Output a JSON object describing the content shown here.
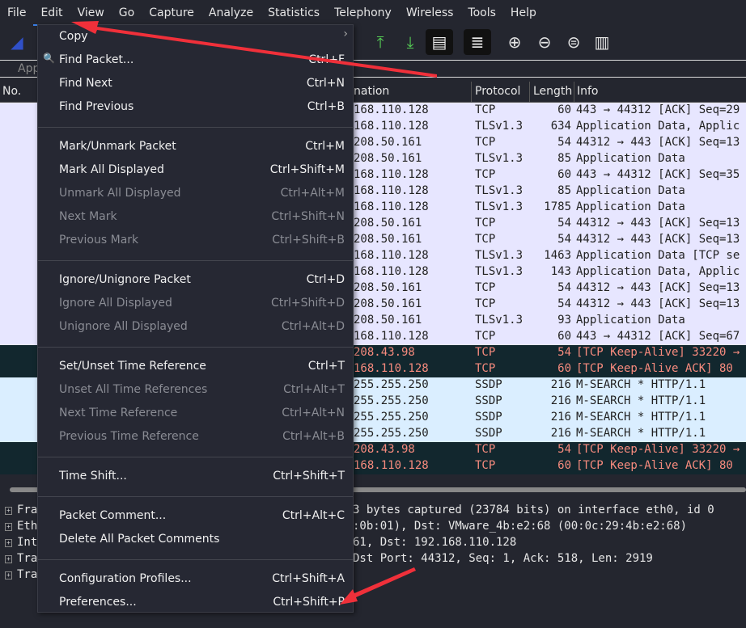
{
  "menubar": [
    "File",
    "Edit",
    "View",
    "Go",
    "Capture",
    "Analyze",
    "Statistics",
    "Telephony",
    "Wireless",
    "Tools",
    "Help"
  ],
  "filter_placeholder": "App",
  "columns": {
    "no": "No.",
    "destination": "nation",
    "protocol": "Protocol",
    "length": "Length",
    "info": "Info"
  },
  "packets": [
    {
      "dst": "168.110.128",
      "proto": "TCP",
      "len": "60",
      "info": "443 → 44312 [ACK] Seq=29",
      "type": "tcp"
    },
    {
      "dst": "168.110.128",
      "proto": "TLSv1.3",
      "len": "634",
      "info": "Application Data, Applic",
      "type": "tcp"
    },
    {
      "dst": "208.50.161",
      "proto": "TCP",
      "len": "54",
      "info": "44312 → 443 [ACK] Seq=13",
      "type": "tcp"
    },
    {
      "dst": "208.50.161",
      "proto": "TLSv1.3",
      "len": "85",
      "info": "Application Data",
      "type": "tcp"
    },
    {
      "dst": "168.110.128",
      "proto": "TCP",
      "len": "60",
      "info": "443 → 44312 [ACK] Seq=35",
      "type": "tcp"
    },
    {
      "dst": "168.110.128",
      "proto": "TLSv1.3",
      "len": "85",
      "info": "Application Data",
      "type": "tcp"
    },
    {
      "dst": "168.110.128",
      "proto": "TLSv1.3",
      "len": "1785",
      "info": "Application Data",
      "type": "tcp"
    },
    {
      "dst": "208.50.161",
      "proto": "TCP",
      "len": "54",
      "info": "44312 → 443 [ACK] Seq=13",
      "type": "tcp"
    },
    {
      "dst": "208.50.161",
      "proto": "TCP",
      "len": "54",
      "info": "44312 → 443 [ACK] Seq=13",
      "type": "tcp"
    },
    {
      "dst": "168.110.128",
      "proto": "TLSv1.3",
      "len": "1463",
      "info": "Application Data [TCP se",
      "type": "tcp"
    },
    {
      "dst": "168.110.128",
      "proto": "TLSv1.3",
      "len": "143",
      "info": "Application Data, Applic",
      "type": "tcp"
    },
    {
      "dst": "208.50.161",
      "proto": "TCP",
      "len": "54",
      "info": "44312 → 443 [ACK] Seq=13",
      "type": "tcp"
    },
    {
      "dst": "208.50.161",
      "proto": "TCP",
      "len": "54",
      "info": "44312 → 443 [ACK] Seq=13",
      "type": "tcp"
    },
    {
      "dst": "208.50.161",
      "proto": "TLSv1.3",
      "len": "93",
      "info": "Application Data",
      "type": "tcp"
    },
    {
      "dst": "168.110.128",
      "proto": "TCP",
      "len": "60",
      "info": "443 → 44312 [ACK] Seq=67",
      "type": "tcp"
    },
    {
      "dst": "208.43.98",
      "proto": "TCP",
      "len": "54",
      "info": "[TCP Keep-Alive] 33220 →",
      "type": "bad"
    },
    {
      "dst": "168.110.128",
      "proto": "TCP",
      "len": "60",
      "info": "[TCP Keep-Alive ACK] 80",
      "type": "bad"
    },
    {
      "dst": "255.255.250",
      "proto": "SSDP",
      "len": "216",
      "info": "M-SEARCH * HTTP/1.1",
      "type": "ssdp"
    },
    {
      "dst": "255.255.250",
      "proto": "SSDP",
      "len": "216",
      "info": "M-SEARCH * HTTP/1.1",
      "type": "ssdp"
    },
    {
      "dst": "255.255.250",
      "proto": "SSDP",
      "len": "216",
      "info": "M-SEARCH * HTTP/1.1",
      "type": "ssdp"
    },
    {
      "dst": "255.255.250",
      "proto": "SSDP",
      "len": "216",
      "info": "M-SEARCH * HTTP/1.1",
      "type": "ssdp"
    },
    {
      "dst": "208.43.98",
      "proto": "TCP",
      "len": "54",
      "info": "[TCP Keep-Alive] 33220 →",
      "type": "bad"
    },
    {
      "dst": "168.110.128",
      "proto": "TCP",
      "len": "60",
      "info": "[TCP Keep-Alive ACK] 80",
      "type": "bad"
    }
  ],
  "details": [
    {
      "label": "Fra",
      "rest": "3 bytes captured (23784 bits) on interface eth0, id 0"
    },
    {
      "label": "Eth",
      "rest": ":0b:01), Dst: VMware_4b:e2:68 (00:0c:29:4b:e2:68)"
    },
    {
      "label": "Int",
      "rest": "61, Dst: 192.168.110.128"
    },
    {
      "label": "Tra",
      "rest": "Dst Port: 44312, Seq: 1, Ack: 518, Len: 2919"
    },
    {
      "label": "Tra",
      "rest": ""
    }
  ],
  "edit_menu": {
    "items": [
      {
        "label": "Copy",
        "shortcut": "",
        "disabled": false,
        "submenu": true
      },
      {
        "label": "Find Packet...",
        "shortcut": "Ctrl+F",
        "disabled": false,
        "icon": "search-icon"
      },
      {
        "label": "Find Next",
        "shortcut": "Ctrl+N",
        "disabled": false
      },
      {
        "label": "Find Previous",
        "shortcut": "Ctrl+B",
        "disabled": false
      },
      {
        "sep": true
      },
      {
        "label": "Mark/Unmark Packet",
        "shortcut": "Ctrl+M",
        "disabled": false
      },
      {
        "label": "Mark All Displayed",
        "shortcut": "Ctrl+Shift+M",
        "disabled": false
      },
      {
        "label": "Unmark All Displayed",
        "shortcut": "Ctrl+Alt+M",
        "disabled": true
      },
      {
        "label": "Next Mark",
        "shortcut": "Ctrl+Shift+N",
        "disabled": true
      },
      {
        "label": "Previous Mark",
        "shortcut": "Ctrl+Shift+B",
        "disabled": true
      },
      {
        "sep": true
      },
      {
        "label": "Ignore/Unignore Packet",
        "shortcut": "Ctrl+D",
        "disabled": false
      },
      {
        "label": "Ignore All Displayed",
        "shortcut": "Ctrl+Shift+D",
        "disabled": true
      },
      {
        "label": "Unignore All Displayed",
        "shortcut": "Ctrl+Alt+D",
        "disabled": true
      },
      {
        "sep": true
      },
      {
        "label": "Set/Unset Time Reference",
        "shortcut": "Ctrl+T",
        "disabled": false
      },
      {
        "label": "Unset All Time References",
        "shortcut": "Ctrl+Alt+T",
        "disabled": true
      },
      {
        "label": "Next Time Reference",
        "shortcut": "Ctrl+Alt+N",
        "disabled": true
      },
      {
        "label": "Previous Time Reference",
        "shortcut": "Ctrl+Alt+B",
        "disabled": true
      },
      {
        "sep": true
      },
      {
        "label": "Time Shift...",
        "shortcut": "Ctrl+Shift+T",
        "disabled": false
      },
      {
        "sep": true
      },
      {
        "label": "Packet Comment...",
        "shortcut": "Ctrl+Alt+C",
        "disabled": false
      },
      {
        "label": "Delete All Packet Comments",
        "shortcut": "",
        "disabled": false
      },
      {
        "sep": true
      },
      {
        "label": "Configuration Profiles...",
        "shortcut": "Ctrl+Shift+A",
        "disabled": false
      },
      {
        "label": "Preferences...",
        "shortcut": "Ctrl+Shift+P",
        "disabled": false
      }
    ]
  },
  "colors": {
    "accent": "#3a7ee6",
    "annotation_arrow": "#f0303a",
    "tcp_row": "#e7e6ff",
    "ssdp_row": "#daeeff",
    "bad_row": "#12272e",
    "bad_text": "#f78b7e"
  }
}
